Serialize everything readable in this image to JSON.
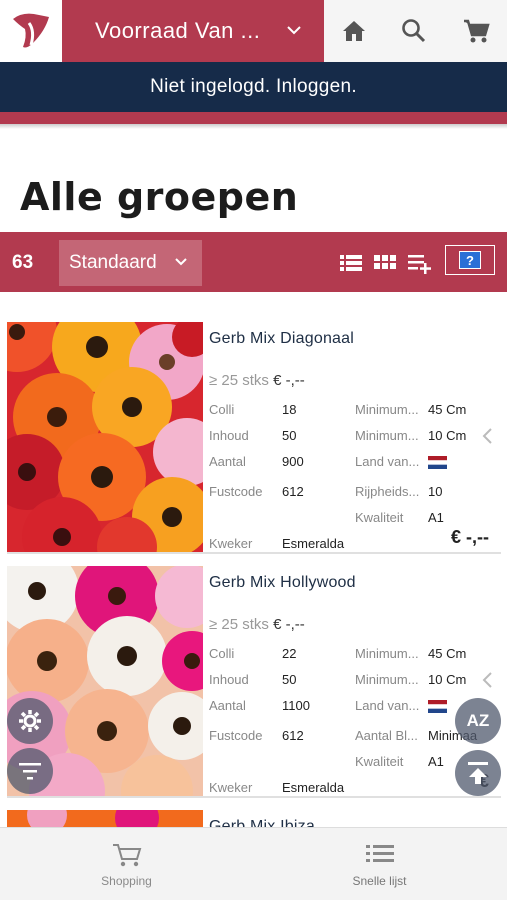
{
  "header": {
    "store_name": "Voorraad Van ...",
    "login_text": "Niet ingelogd. Inloggen."
  },
  "page": {
    "title": "Alle groepen"
  },
  "toolbar": {
    "count": "63",
    "sort_value": "Standaard",
    "help_label": "?"
  },
  "labels": {
    "colli": "Colli",
    "inhoud": "Inhoud",
    "aantal": "Aantal",
    "fustcode": "Fustcode",
    "minimum1": "Minimum...",
    "minimum2": "Minimum...",
    "land": "Land van...",
    "kwaliteit": "Kwaliteit",
    "kweker": "Kweker"
  },
  "products": [
    {
      "name": "Gerb Mix Diagonaal",
      "price_qty": "≥ 25 stks",
      "price": "€ -,--",
      "colli": "18",
      "inhoud": "50",
      "aantal": "900",
      "fustcode": "612",
      "min1": "45 Cm",
      "min2": "10 Cm",
      "extra_label": "Rijpheids...",
      "extra_value": "10",
      "kwaliteit": "A1",
      "kweker": "Esmeralda",
      "big_price": "€ -,--"
    },
    {
      "name": "Gerb Mix Hollywood",
      "price_qty": "≥ 25 stks",
      "price": "€ -,--",
      "colli": "22",
      "inhoud": "50",
      "aantal": "1100",
      "fustcode": "612",
      "min1": "45 Cm",
      "min2": "10 Cm",
      "extra_label": "Aantal Bl...",
      "extra_value": "Minimaa",
      "kwaliteit": "A1",
      "kweker": "Esmeralda",
      "big_price": "€"
    },
    {
      "name": "Gerb Mix Ibiza"
    }
  ],
  "fab": {
    "sort_az": "AZ"
  },
  "bottom_nav": {
    "shopping": "Shopping",
    "quick_list": "Snelle lijst"
  },
  "colors": {
    "brand_red": "#b23a4f",
    "navy": "#162b49"
  }
}
